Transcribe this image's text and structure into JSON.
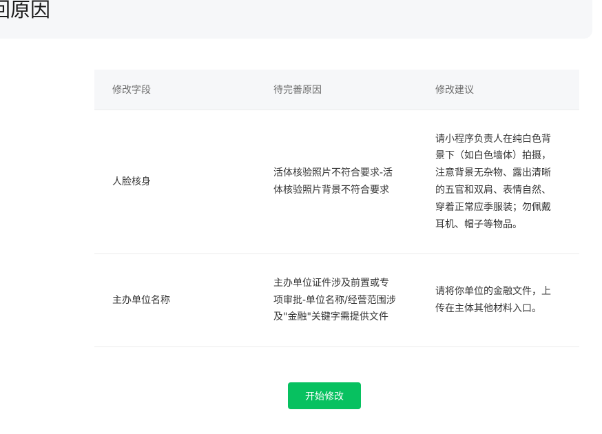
{
  "page": {
    "title": "回原因"
  },
  "table": {
    "headers": [
      "修改字段",
      "待完善原因",
      "修改建议"
    ],
    "rows": [
      {
        "field": "人脸核身",
        "reason": "活体核验照片不符合要求-活体核验照片背景不符合要求",
        "suggestion": "请小程序负责人在纯白色背景下（如白色墙体）拍摄，注意背景无杂物、露出清晰的五官和双肩、表情自然、穿着正常应季服装；勿佩戴耳机、帽子等物品。"
      },
      {
        "field": "主办单位名称",
        "reason": "主办单位证件涉及前置或专项审批-单位名称/经营范围涉及\"金融\"关键字需提供文件",
        "suggestion": "请将你单位的金融文件，上传在主体其他材料入口。"
      }
    ]
  },
  "actions": {
    "start_edit_label": "开始修改"
  },
  "colors": {
    "primary": "#07c160",
    "header_bg": "#f6f7f9",
    "divider": "#ebebeb"
  }
}
